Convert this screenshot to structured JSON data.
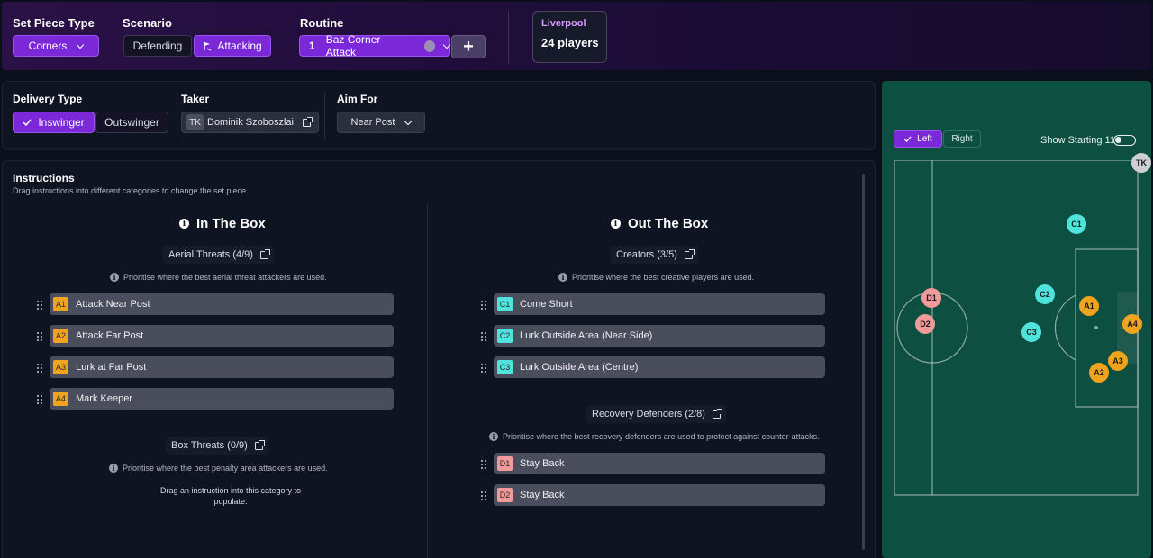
{
  "topbar": {
    "set_piece_label": "Set Piece Type",
    "set_piece_value": "Corners",
    "scenario_label": "Scenario",
    "scenario_defending": "Defending",
    "scenario_attacking": "Attacking",
    "routine_label": "Routine",
    "routine_number": "1",
    "routine_name": "Baz Corner Attack",
    "add_symbol": "+",
    "team_name": "Liverpool",
    "team_players": "24 players"
  },
  "delivery": {
    "delivery_label": "Delivery Type",
    "inswinger": "Inswinger",
    "outswinger": "Outswinger",
    "taker_label": "Taker",
    "taker_badge": "TK",
    "taker_name": "Dominik Szoboszlai",
    "aim_label": "Aim For",
    "aim_value": "Near Post"
  },
  "instructions": {
    "title": "Instructions",
    "subtitle": "Drag instructions into different categories to change the set piece.",
    "in_box": {
      "title": "In The Box",
      "aerial_label": "Aerial Threats (4/9)",
      "aerial_hint": "Prioritise where the best aerial threat attackers are used.",
      "aerial_rows": [
        {
          "badge": "A1",
          "label": "Attack Near Post"
        },
        {
          "badge": "A2",
          "label": "Attack Far Post"
        },
        {
          "badge": "A3",
          "label": "Lurk at Far Post"
        },
        {
          "badge": "A4",
          "label": "Mark Keeper"
        }
      ],
      "box_label": "Box Threats (0/9)",
      "box_hint": "Prioritise where the best penalty area attackers are used.",
      "box_empty_1": "Drag an instruction into this category to",
      "box_empty_2": "populate."
    },
    "out_box": {
      "title": "Out The Box",
      "creators_label": "Creators (3/5)",
      "creators_hint": "Prioritise where the best creative players are used.",
      "creators_rows": [
        {
          "badge": "C1",
          "label": "Come Short"
        },
        {
          "badge": "C2",
          "label": "Lurk Outside Area (Near Side)"
        },
        {
          "badge": "C3",
          "label": "Lurk Outside Area (Centre)"
        }
      ],
      "recovery_label": "Recovery Defenders (2/8)",
      "recovery_hint": "Prioritise where the best recovery defenders are used to protect against counter-attacks.",
      "recovery_rows": [
        {
          "badge": "D1",
          "label": "Stay Back"
        },
        {
          "badge": "D2",
          "label": "Stay Back"
        }
      ]
    }
  },
  "pitch": {
    "side_left": "Left",
    "side_right": "Right",
    "show_starting": "Show Starting 11",
    "tk": "TK",
    "markers": {
      "C1": "C1",
      "C2": "C2",
      "C3": "C3",
      "D1": "D1",
      "D2": "D2",
      "A1": "A1",
      "A2": "A2",
      "A3": "A3",
      "A4": "A4"
    }
  },
  "colors": {
    "accent_purple": "#7b28d8",
    "attacker": "#f0a41e",
    "creator": "#4fe3dc",
    "defender": "#f29a9a",
    "pitch": "#0d4f40"
  }
}
